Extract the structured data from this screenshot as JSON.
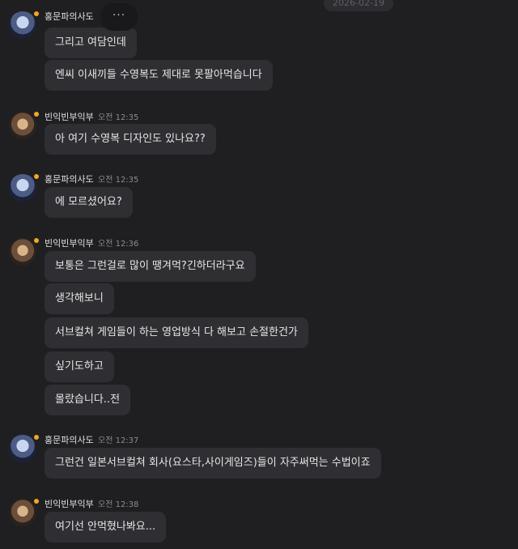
{
  "date_label": "2026-02-19",
  "more_label": "···",
  "groups": [
    {
      "name": "홍문파의사도",
      "time": "",
      "messages": [
        "그리고 여담인데",
        "엔씨 이새끼들 수영복도 제대로 못팔아먹습니다"
      ]
    },
    {
      "name": "빈익빈부익부",
      "time": "오전 12:35",
      "messages": [
        "아 여기 수영복 디자인도 있나요??"
      ]
    },
    {
      "name": "홍문파의사도",
      "time": "오전 12:35",
      "messages": [
        "에 모르셨어요?"
      ]
    },
    {
      "name": "빈익빈부익부",
      "time": "오전 12:36",
      "messages": [
        "보통은 그런걸로 많이 땡겨먹?긴하더라구요",
        "생각해보니",
        "서브컬쳐 게임들이 하는 영업방식 다 해보고 손절한건가",
        "싶기도하고",
        "몰랐습니다..전"
      ]
    },
    {
      "name": "홍문파의사도",
      "time": "오전 12:37",
      "messages": [
        "그런건 일본서브컬쳐 회사(요스타,사이게임즈)들이 자주써먹는 수법이죠"
      ]
    },
    {
      "name": "빈익빈부익부",
      "time": "오전 12:38",
      "messages": [
        "여기선 안먹혔나봐요..."
      ]
    }
  ]
}
